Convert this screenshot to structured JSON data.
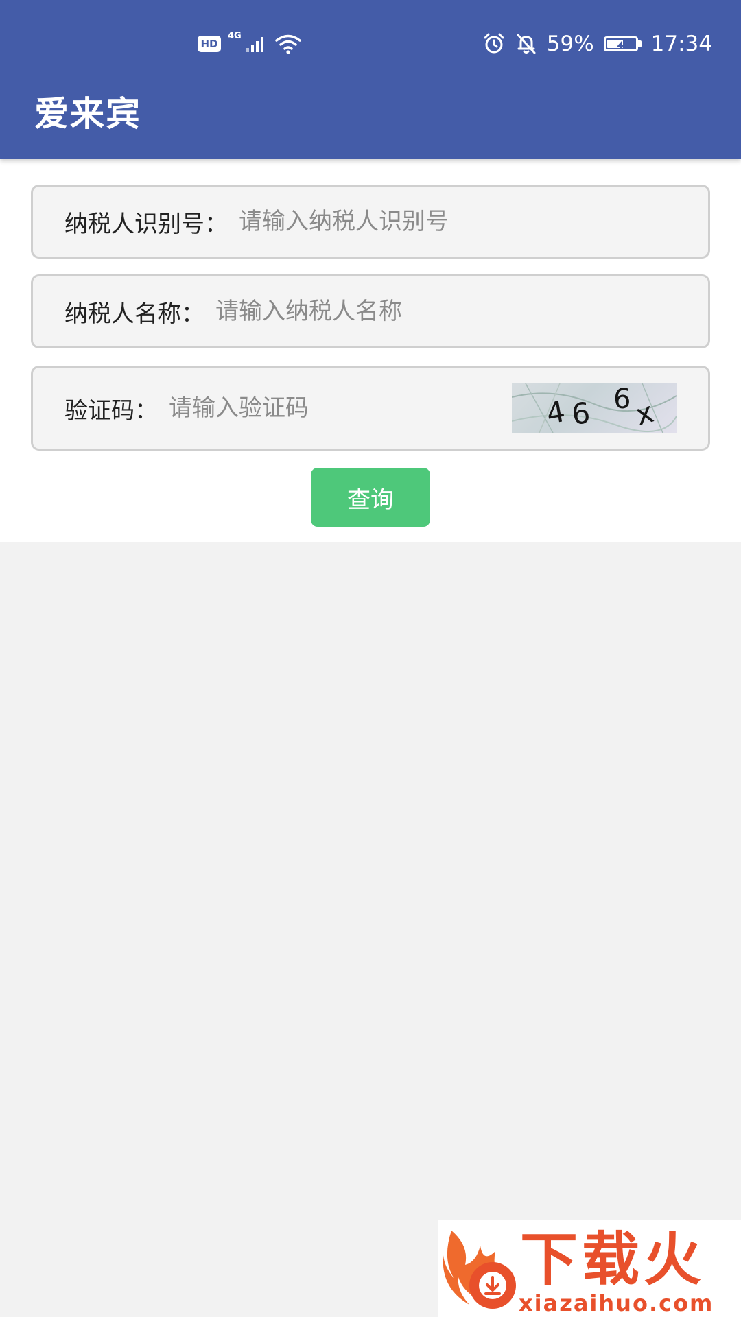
{
  "status_bar": {
    "hd": "HD",
    "network": "4G",
    "battery": "59%",
    "battery_level": 0.59,
    "time": "17:34"
  },
  "app": {
    "title": "爱来宾"
  },
  "form": {
    "taxpayer_id": {
      "label": "纳税人识别号：",
      "placeholder": "请输入纳税人识别号",
      "value": ""
    },
    "taxpayer_name": {
      "label": "纳税人名称：",
      "placeholder": "请输入纳税人名称",
      "value": ""
    },
    "captcha": {
      "label": "验证码：",
      "placeholder": "请输入验证码",
      "value": "",
      "image_text": "466x"
    },
    "submit_label": "查询"
  },
  "watermark": {
    "text": "下载火",
    "domain": "xiazaihuo.com"
  },
  "colors": {
    "header": "#445ca8",
    "button": "#4ec87a",
    "background": "#f2f2f2",
    "watermark": "#e8502b"
  },
  "icons": {
    "signal": "signal-icon",
    "wifi": "wifi-icon",
    "alarm": "alarm-icon",
    "mute": "bell-off-icon",
    "battery": "battery-icon",
    "watermark_logo": "flame-logo-icon"
  }
}
